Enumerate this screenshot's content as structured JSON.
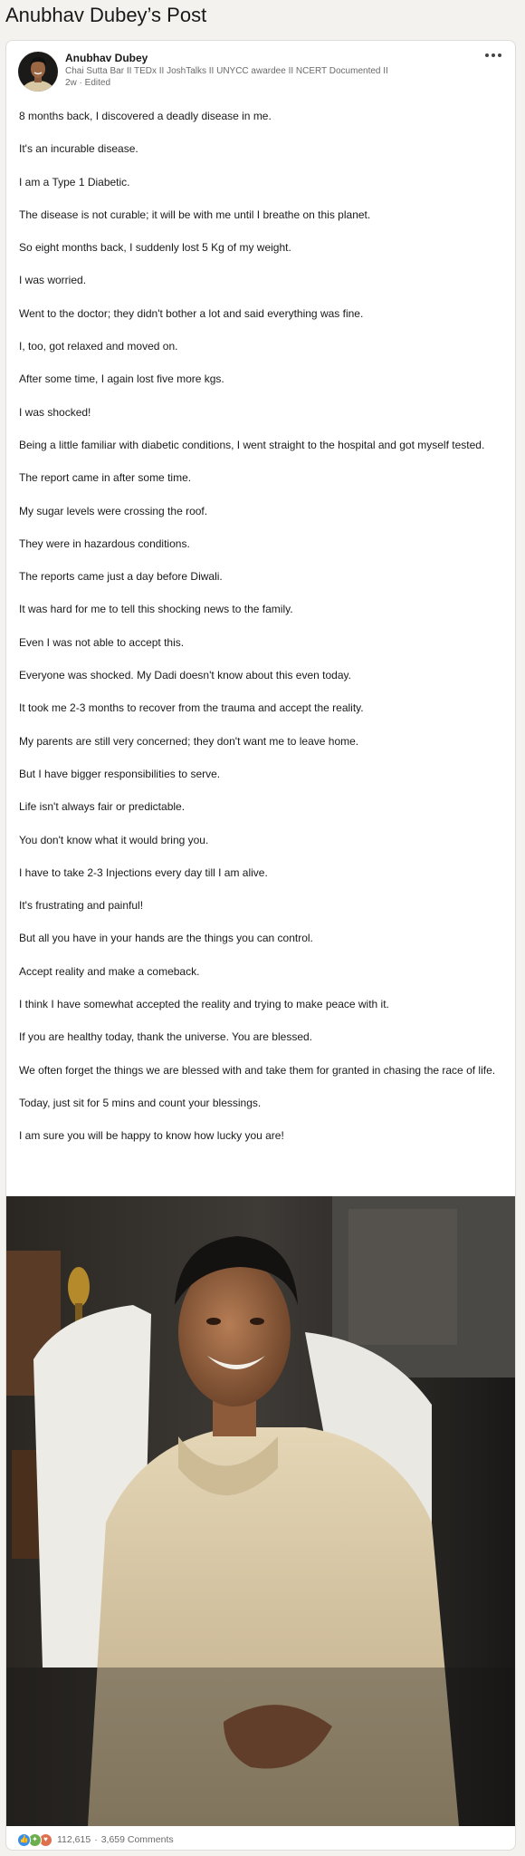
{
  "page": {
    "title": "Anubhav Dubey’s Post"
  },
  "author": {
    "name": "Anubhav Dubey",
    "headline": "Chai Sutta Bar II TEDx II JoshTalks II UNYCC awardee II NCERT Documented II",
    "meta": "2w · Edited"
  },
  "post": {
    "paragraphs": [
      "8 months back, I discovered a deadly disease in me.",
      "It's an incurable disease.",
      "I am a Type 1 Diabetic.",
      "The disease is not curable; it will be with me until I breathe on this planet.",
      "So eight months back, I suddenly lost 5 Kg of my weight.",
      "I was worried.",
      "Went to the doctor; they didn't bother a lot and said everything was fine.",
      "I, too, got relaxed and moved on.",
      "After some time, I again lost five more kgs.",
      "I was shocked!",
      "Being a little familiar with diabetic conditions, I went straight to the hospital and got myself tested.",
      "The report came in after some time.",
      "My sugar levels were crossing the roof.",
      "They were in hazardous conditions.",
      "The reports came just a day before Diwali.",
      "It was hard for me to tell this shocking news to the family.",
      "Even I was not able to accept this.",
      "Everyone was shocked. My Dadi doesn't know about this even today.",
      "It took me 2-3 months to recover from the trauma and accept the reality.",
      "My parents are still very concerned; they don't want me to leave home.",
      "But I have bigger responsibilities to serve.",
      "Life isn't always fair or predictable.",
      "You don't know what it would bring you.",
      "I have to take 2-3 Injections every day till I am alive.",
      "It's frustrating and painful!",
      "But all you have in your hands are the things you can control.",
      "Accept reality and make a comeback.",
      "I think I have somewhat accepted the reality and trying to make peace with it.",
      "If you are healthy today, thank the universe. You are blessed.",
      "We often forget the things we are blessed with and take them for granted in chasing the race of life.",
      "Today, just sit for 5 mins and count your blessings.",
      "I am sure you will be happy to know how lucky you are!"
    ]
  },
  "social": {
    "reactions_icons": [
      "like-icon",
      "celebrate-icon",
      "love-icon"
    ],
    "reaction_count": "112,615",
    "separator": "·",
    "comments": "3,659 Comments"
  },
  "colors": {
    "like": "#378fe9",
    "celebrate": "#6dae4f",
    "love": "#df704d",
    "card_bg": "#ffffff",
    "page_bg": "#f3f2ef"
  }
}
